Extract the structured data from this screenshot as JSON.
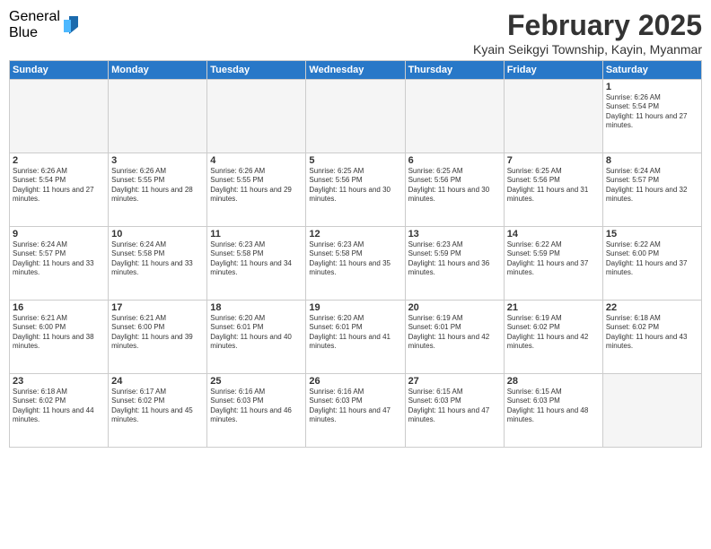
{
  "logo": {
    "general": "General",
    "blue": "Blue"
  },
  "title": "February 2025",
  "location": "Kyain Seikgyi Township, Kayin, Myanmar",
  "headers": [
    "Sunday",
    "Monday",
    "Tuesday",
    "Wednesday",
    "Thursday",
    "Friday",
    "Saturday"
  ],
  "weeks": [
    [
      {
        "day": "",
        "text": ""
      },
      {
        "day": "",
        "text": ""
      },
      {
        "day": "",
        "text": ""
      },
      {
        "day": "",
        "text": ""
      },
      {
        "day": "",
        "text": ""
      },
      {
        "day": "",
        "text": ""
      },
      {
        "day": "1",
        "text": "Sunrise: 6:26 AM\nSunset: 5:54 PM\nDaylight: 11 hours and 27 minutes."
      }
    ],
    [
      {
        "day": "2",
        "text": "Sunrise: 6:26 AM\nSunset: 5:54 PM\nDaylight: 11 hours and 27 minutes."
      },
      {
        "day": "3",
        "text": "Sunrise: 6:26 AM\nSunset: 5:55 PM\nDaylight: 11 hours and 28 minutes."
      },
      {
        "day": "4",
        "text": "Sunrise: 6:26 AM\nSunset: 5:55 PM\nDaylight: 11 hours and 29 minutes."
      },
      {
        "day": "5",
        "text": "Sunrise: 6:25 AM\nSunset: 5:56 PM\nDaylight: 11 hours and 30 minutes."
      },
      {
        "day": "6",
        "text": "Sunrise: 6:25 AM\nSunset: 5:56 PM\nDaylight: 11 hours and 30 minutes."
      },
      {
        "day": "7",
        "text": "Sunrise: 6:25 AM\nSunset: 5:56 PM\nDaylight: 11 hours and 31 minutes."
      },
      {
        "day": "8",
        "text": "Sunrise: 6:24 AM\nSunset: 5:57 PM\nDaylight: 11 hours and 32 minutes."
      }
    ],
    [
      {
        "day": "9",
        "text": "Sunrise: 6:24 AM\nSunset: 5:57 PM\nDaylight: 11 hours and 33 minutes."
      },
      {
        "day": "10",
        "text": "Sunrise: 6:24 AM\nSunset: 5:58 PM\nDaylight: 11 hours and 33 minutes."
      },
      {
        "day": "11",
        "text": "Sunrise: 6:23 AM\nSunset: 5:58 PM\nDaylight: 11 hours and 34 minutes."
      },
      {
        "day": "12",
        "text": "Sunrise: 6:23 AM\nSunset: 5:58 PM\nDaylight: 11 hours and 35 minutes."
      },
      {
        "day": "13",
        "text": "Sunrise: 6:23 AM\nSunset: 5:59 PM\nDaylight: 11 hours and 36 minutes."
      },
      {
        "day": "14",
        "text": "Sunrise: 6:22 AM\nSunset: 5:59 PM\nDaylight: 11 hours and 37 minutes."
      },
      {
        "day": "15",
        "text": "Sunrise: 6:22 AM\nSunset: 6:00 PM\nDaylight: 11 hours and 37 minutes."
      }
    ],
    [
      {
        "day": "16",
        "text": "Sunrise: 6:21 AM\nSunset: 6:00 PM\nDaylight: 11 hours and 38 minutes."
      },
      {
        "day": "17",
        "text": "Sunrise: 6:21 AM\nSunset: 6:00 PM\nDaylight: 11 hours and 39 minutes."
      },
      {
        "day": "18",
        "text": "Sunrise: 6:20 AM\nSunset: 6:01 PM\nDaylight: 11 hours and 40 minutes."
      },
      {
        "day": "19",
        "text": "Sunrise: 6:20 AM\nSunset: 6:01 PM\nDaylight: 11 hours and 41 minutes."
      },
      {
        "day": "20",
        "text": "Sunrise: 6:19 AM\nSunset: 6:01 PM\nDaylight: 11 hours and 42 minutes."
      },
      {
        "day": "21",
        "text": "Sunrise: 6:19 AM\nSunset: 6:02 PM\nDaylight: 11 hours and 42 minutes."
      },
      {
        "day": "22",
        "text": "Sunrise: 6:18 AM\nSunset: 6:02 PM\nDaylight: 11 hours and 43 minutes."
      }
    ],
    [
      {
        "day": "23",
        "text": "Sunrise: 6:18 AM\nSunset: 6:02 PM\nDaylight: 11 hours and 44 minutes."
      },
      {
        "day": "24",
        "text": "Sunrise: 6:17 AM\nSunset: 6:02 PM\nDaylight: 11 hours and 45 minutes."
      },
      {
        "day": "25",
        "text": "Sunrise: 6:16 AM\nSunset: 6:03 PM\nDaylight: 11 hours and 46 minutes."
      },
      {
        "day": "26",
        "text": "Sunrise: 6:16 AM\nSunset: 6:03 PM\nDaylight: 11 hours and 47 minutes."
      },
      {
        "day": "27",
        "text": "Sunrise: 6:15 AM\nSunset: 6:03 PM\nDaylight: 11 hours and 47 minutes."
      },
      {
        "day": "28",
        "text": "Sunrise: 6:15 AM\nSunset: 6:03 PM\nDaylight: 11 hours and 48 minutes."
      },
      {
        "day": "",
        "text": ""
      }
    ]
  ]
}
